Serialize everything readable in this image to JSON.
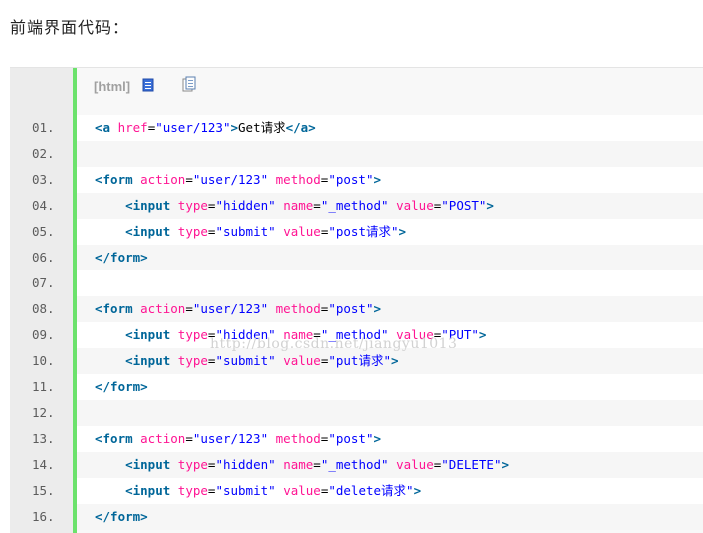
{
  "heading": "前端界面代码：",
  "toolbar": {
    "label": "[html]",
    "view_source_icon": "view-source-icon",
    "copy_icon": "copy-icon"
  },
  "colors": {
    "tag": "#006699",
    "attribute": "#ff1493",
    "value": "#0000ff",
    "gutter_bar": "#6ce26c"
  },
  "watermark": "http://blog.csdn.net/jiangyu1013",
  "lines": [
    {
      "num": "01.",
      "tokens": [
        [
          "tag",
          "<a "
        ],
        [
          "attr",
          "href"
        ],
        [
          "text",
          "="
        ],
        [
          "val",
          "\"user/123\""
        ],
        [
          "tag",
          ">"
        ],
        [
          "text",
          "Get请求"
        ],
        [
          "tag",
          "</a>"
        ]
      ]
    },
    {
      "num": "02.",
      "tokens": []
    },
    {
      "num": "03.",
      "tokens": [
        [
          "tag",
          "<form "
        ],
        [
          "attr",
          "action"
        ],
        [
          "text",
          "="
        ],
        [
          "val",
          "\"user/123\""
        ],
        [
          "text",
          " "
        ],
        [
          "attr",
          "method"
        ],
        [
          "text",
          "="
        ],
        [
          "val",
          "\"post\""
        ],
        [
          "tag",
          ">"
        ]
      ]
    },
    {
      "num": "04.",
      "tokens": [
        [
          "text",
          "    "
        ],
        [
          "tag",
          "<input "
        ],
        [
          "attr",
          "type"
        ],
        [
          "text",
          "="
        ],
        [
          "val",
          "\"hidden\""
        ],
        [
          "text",
          " "
        ],
        [
          "attr",
          "name"
        ],
        [
          "text",
          "="
        ],
        [
          "val",
          "\"_method\""
        ],
        [
          "text",
          " "
        ],
        [
          "attr",
          "value"
        ],
        [
          "text",
          "="
        ],
        [
          "val",
          "\"POST\""
        ],
        [
          "tag",
          ">"
        ]
      ]
    },
    {
      "num": "05.",
      "tokens": [
        [
          "text",
          "    "
        ],
        [
          "tag",
          "<input "
        ],
        [
          "attr",
          "type"
        ],
        [
          "text",
          "="
        ],
        [
          "val",
          "\"submit\""
        ],
        [
          "text",
          " "
        ],
        [
          "attr",
          "value"
        ],
        [
          "text",
          "="
        ],
        [
          "val",
          "\"post请求\""
        ],
        [
          "tag",
          ">"
        ]
      ]
    },
    {
      "num": "06.",
      "tokens": [
        [
          "tag",
          "</form>"
        ]
      ]
    },
    {
      "num": "07.",
      "tokens": []
    },
    {
      "num": "08.",
      "tokens": [
        [
          "tag",
          "<form "
        ],
        [
          "attr",
          "action"
        ],
        [
          "text",
          "="
        ],
        [
          "val",
          "\"user/123\""
        ],
        [
          "text",
          " "
        ],
        [
          "attr",
          "method"
        ],
        [
          "text",
          "="
        ],
        [
          "val",
          "\"post\""
        ],
        [
          "tag",
          ">"
        ]
      ]
    },
    {
      "num": "09.",
      "tokens": [
        [
          "text",
          "    "
        ],
        [
          "tag",
          "<input "
        ],
        [
          "attr",
          "type"
        ],
        [
          "text",
          "="
        ],
        [
          "val",
          "\"hidden\""
        ],
        [
          "text",
          " "
        ],
        [
          "attr",
          "name"
        ],
        [
          "text",
          "="
        ],
        [
          "val",
          "\"_method\""
        ],
        [
          "text",
          " "
        ],
        [
          "attr",
          "value"
        ],
        [
          "text",
          "="
        ],
        [
          "val",
          "\"PUT\""
        ],
        [
          "tag",
          ">"
        ]
      ]
    },
    {
      "num": "10.",
      "tokens": [
        [
          "text",
          "    "
        ],
        [
          "tag",
          "<input "
        ],
        [
          "attr",
          "type"
        ],
        [
          "text",
          "="
        ],
        [
          "val",
          "\"submit\""
        ],
        [
          "text",
          " "
        ],
        [
          "attr",
          "value"
        ],
        [
          "text",
          "="
        ],
        [
          "val",
          "\"put请求\""
        ],
        [
          "tag",
          ">"
        ]
      ]
    },
    {
      "num": "11.",
      "tokens": [
        [
          "tag",
          "</form>"
        ]
      ]
    },
    {
      "num": "12.",
      "tokens": []
    },
    {
      "num": "13.",
      "tokens": [
        [
          "tag",
          "<form "
        ],
        [
          "attr",
          "action"
        ],
        [
          "text",
          "="
        ],
        [
          "val",
          "\"user/123\""
        ],
        [
          "text",
          " "
        ],
        [
          "attr",
          "method"
        ],
        [
          "text",
          "="
        ],
        [
          "val",
          "\"post\""
        ],
        [
          "tag",
          ">"
        ]
      ]
    },
    {
      "num": "14.",
      "tokens": [
        [
          "text",
          "    "
        ],
        [
          "tag",
          "<input "
        ],
        [
          "attr",
          "type"
        ],
        [
          "text",
          "="
        ],
        [
          "val",
          "\"hidden\""
        ],
        [
          "text",
          " "
        ],
        [
          "attr",
          "name"
        ],
        [
          "text",
          "="
        ],
        [
          "val",
          "\"_method\""
        ],
        [
          "text",
          " "
        ],
        [
          "attr",
          "value"
        ],
        [
          "text",
          "="
        ],
        [
          "val",
          "\"DELETE\""
        ],
        [
          "tag",
          ">"
        ]
      ]
    },
    {
      "num": "15.",
      "tokens": [
        [
          "text",
          "    "
        ],
        [
          "tag",
          "<input "
        ],
        [
          "attr",
          "type"
        ],
        [
          "text",
          "="
        ],
        [
          "val",
          "\"submit\""
        ],
        [
          "text",
          " "
        ],
        [
          "attr",
          "value"
        ],
        [
          "text",
          "="
        ],
        [
          "val",
          "\"delete请求\""
        ],
        [
          "tag",
          ">"
        ]
      ]
    },
    {
      "num": "16.",
      "tokens": [
        [
          "tag",
          "</form>"
        ]
      ]
    }
  ]
}
